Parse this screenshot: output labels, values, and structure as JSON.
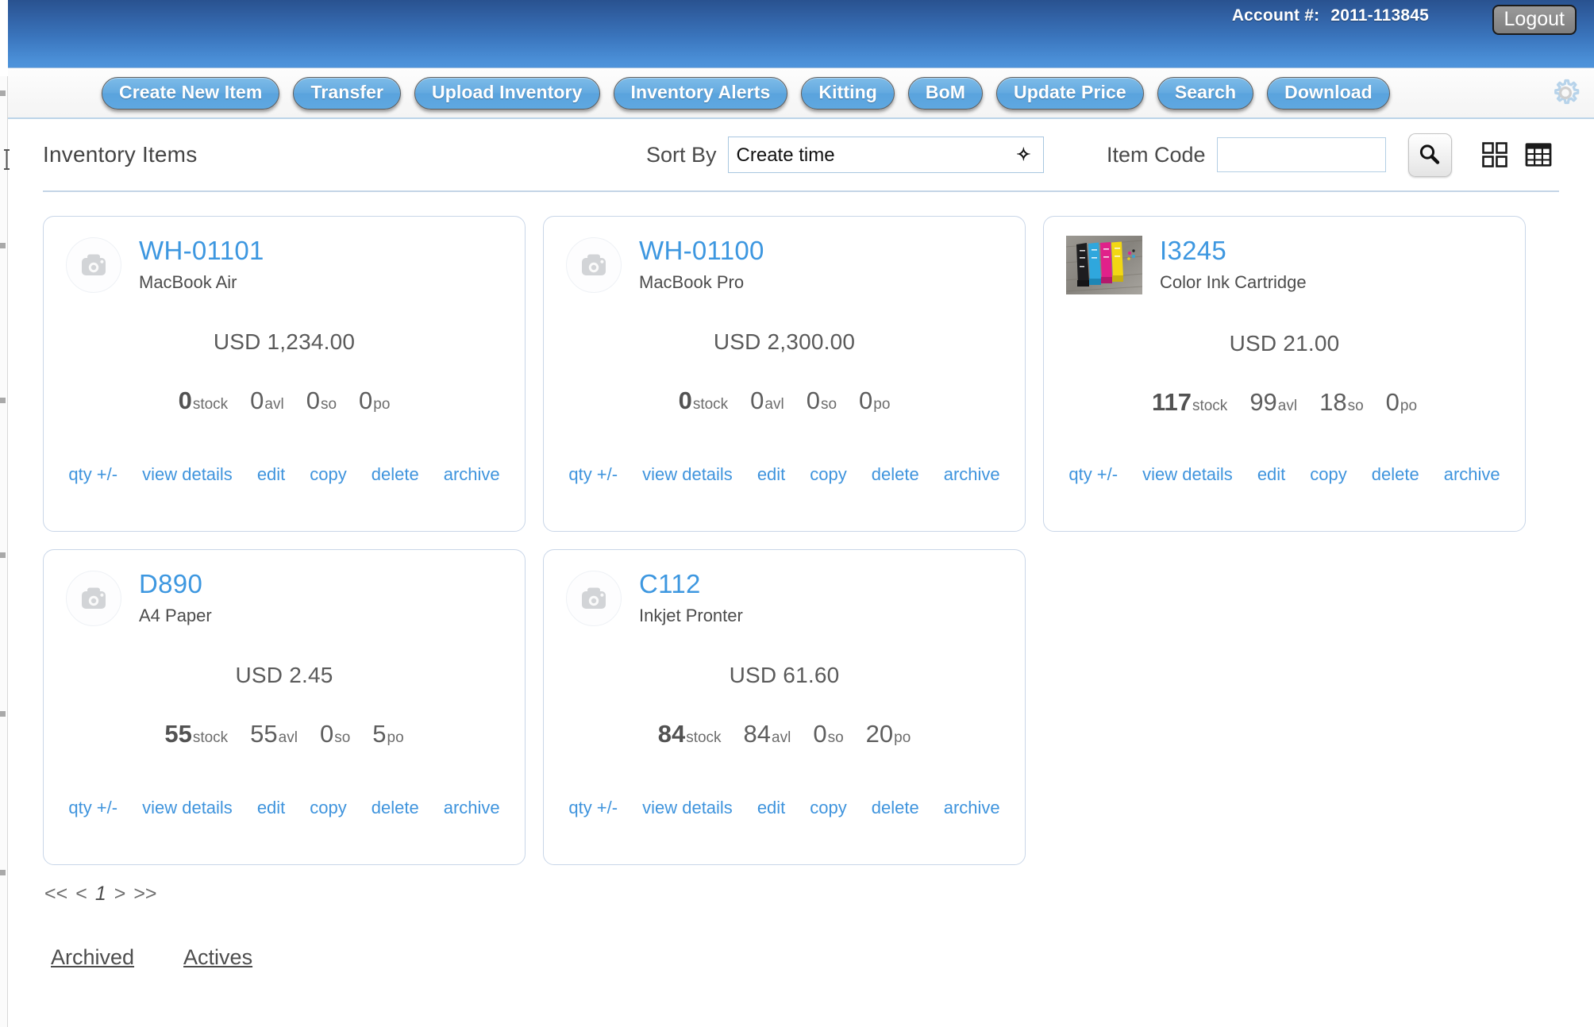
{
  "header": {
    "account_label": "Account #:",
    "account_number": "2011-113845",
    "logout_label": "Logout"
  },
  "nav": {
    "items": [
      {
        "label": "Create New Item",
        "name": "create-new-item"
      },
      {
        "label": "Transfer",
        "name": "transfer"
      },
      {
        "label": "Upload Inventory",
        "name": "upload-inventory"
      },
      {
        "label": "Inventory Alerts",
        "name": "inventory-alerts"
      },
      {
        "label": "Kitting",
        "name": "kitting"
      },
      {
        "label": "BoM",
        "name": "bom"
      },
      {
        "label": "Update Price",
        "name": "update-price"
      },
      {
        "label": "Search",
        "name": "search"
      },
      {
        "label": "Download",
        "name": "download"
      }
    ],
    "settings_icon": "gear-icon"
  },
  "toolbar": {
    "section_title": "Inventory Items",
    "sort_label": "Sort By",
    "sort_value": "Create time",
    "sort_options": [
      "Create time"
    ],
    "item_code_label": "Item Code",
    "item_code_value": "",
    "item_code_placeholder": "",
    "search_icon": "search-icon",
    "grid_view_icon": "grid-view-icon",
    "table_view_icon": "table-view-icon"
  },
  "actions": {
    "qty": "qty +/-",
    "view_details": "view details",
    "edit": "edit",
    "copy": "copy",
    "delete": "delete",
    "archive": "archive"
  },
  "stat_labels": {
    "stock": "stock",
    "avl": "avl",
    "so": "so",
    "po": "po"
  },
  "items": [
    {
      "code": "WH-01101",
      "description": "MacBook Air",
      "price": "USD 1,234.00",
      "stock": "0",
      "avl": "0",
      "so": "0",
      "po": "0",
      "thumb": "placeholder"
    },
    {
      "code": "WH-01100",
      "description": "MacBook Pro",
      "price": "USD 2,300.00",
      "stock": "0",
      "avl": "0",
      "so": "0",
      "po": "0",
      "thumb": "placeholder"
    },
    {
      "code": "I3245",
      "description": "Color Ink Cartridge",
      "price": "USD 21.00",
      "stock": "117",
      "avl": "99",
      "so": "18",
      "po": "0",
      "thumb": "ink-cartridges-photo"
    },
    {
      "code": "D890",
      "description": "A4 Paper",
      "price": "USD 2.45",
      "stock": "55",
      "avl": "55",
      "so": "0",
      "po": "5",
      "thumb": "placeholder"
    },
    {
      "code": "C112",
      "description": "Inkjet Pronter",
      "price": "USD 61.60",
      "stock": "84",
      "avl": "84",
      "so": "0",
      "po": "20",
      "thumb": "placeholder"
    }
  ],
  "pagination": {
    "first": "<<",
    "prev": "<",
    "current": "1",
    "next": ">",
    "last": ">>"
  },
  "footer": {
    "archived": "Archived",
    "actives": "Actives"
  },
  "colors": {
    "accent_blue": "#3d97e0",
    "header_blue_top": "#29528f",
    "header_blue_bottom": "#4d93db",
    "card_border": "#c9d6e8"
  }
}
